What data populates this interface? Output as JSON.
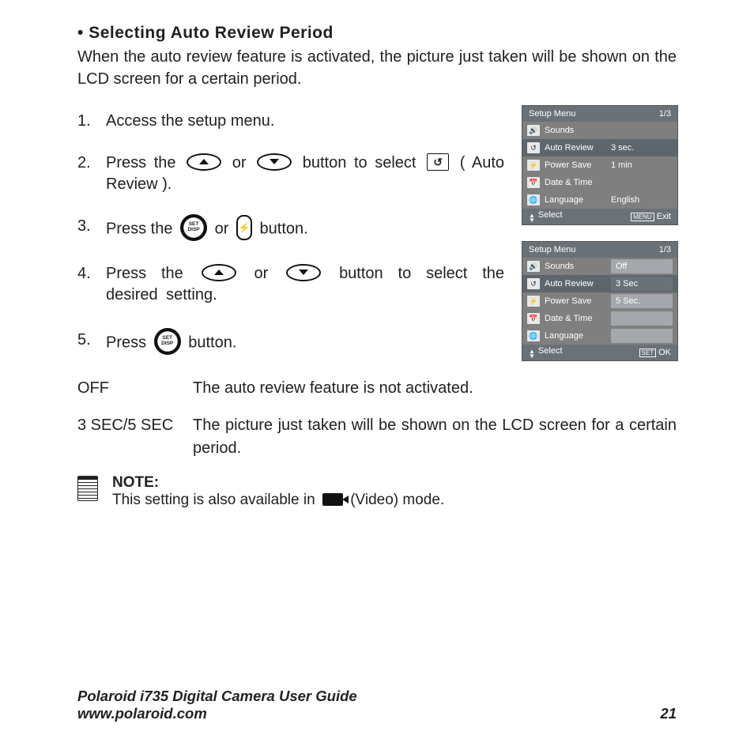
{
  "heading_bullet": "•",
  "heading": "Selecting Auto Review Period",
  "intro": "When the auto review feature is activated, the picture just taken will be shown on the LCD screen for a certain period.",
  "steps": {
    "s1": {
      "num": "1.",
      "text": "Access the setup menu."
    },
    "s2": {
      "num": "2.",
      "a": "Press the ",
      "b": " or ",
      "c": " button to select ",
      "d": " ( Auto Review )."
    },
    "s3": {
      "num": "3.",
      "a": "Press the ",
      "b": " or ",
      "c": " button."
    },
    "s4": {
      "num": "4.",
      "a": "Press the ",
      "b": " or ",
      "c": " button to select the desired setting."
    },
    "s5": {
      "num": "5.",
      "a": "Press ",
      "b": " button."
    }
  },
  "defs": {
    "off": {
      "k": "OFF",
      "v": "The auto review feature is not activated."
    },
    "sec": {
      "k": "3 SEC/5 SEC",
      "v": "The picture just taken will be shown on the LCD screen for a certain period."
    }
  },
  "note": {
    "label": "NOTE:",
    "a": "This setting is also available in ",
    "b": " (Video) mode."
  },
  "icons": {
    "setdisp_top": "SET",
    "setdisp_bot": "DISP",
    "rect": "↺",
    "flash": "⚡"
  },
  "screens": {
    "a": {
      "title": "Setup Menu",
      "page": "1/3",
      "rows": [
        {
          "ic": "🔊",
          "lab": "Sounds",
          "val": ""
        },
        {
          "ic": "↺",
          "lab": "Auto Review",
          "val": "3 sec.",
          "hl": true
        },
        {
          "ic": "⚡",
          "lab": "Power Save",
          "val": "1 min"
        },
        {
          "ic": "📅",
          "lab": "Date & Time",
          "val": ""
        },
        {
          "ic": "🌐",
          "lab": "Language",
          "val": "English"
        }
      ],
      "foot_l": "Select",
      "foot_r": "Exit"
    },
    "b": {
      "title": "Setup Menu",
      "page": "1/3",
      "rows": [
        {
          "ic": "🔊",
          "lab": "Sounds",
          "val": "Off"
        },
        {
          "ic": "↺",
          "lab": "Auto Review",
          "val": "3 Sec",
          "hl": true,
          "sel": true
        },
        {
          "ic": "⚡",
          "lab": "Power Save",
          "val": "5 Sec."
        },
        {
          "ic": "📅",
          "lab": "Date & Time",
          "val": ""
        },
        {
          "ic": "🌐",
          "lab": "Language",
          "val": ""
        }
      ],
      "foot_l": "Select",
      "foot_r": "OK"
    }
  },
  "footer": {
    "guide": "Polaroid i735 Digital Camera User Guide",
    "url": "www.polaroid.com",
    "page": "21"
  }
}
